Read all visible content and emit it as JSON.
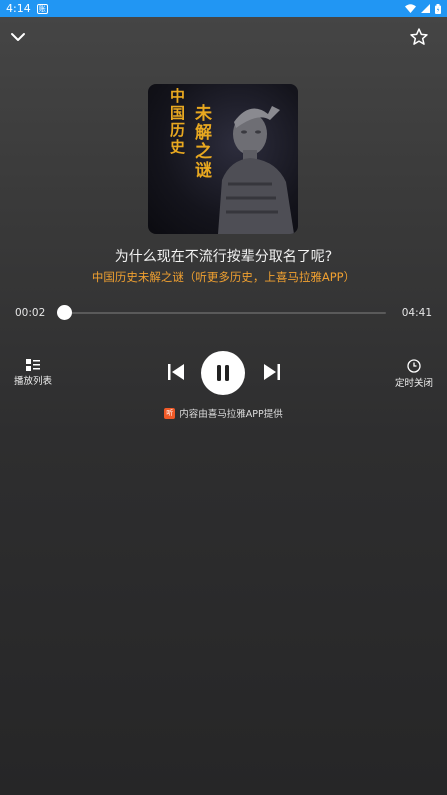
{
  "status_bar": {
    "time": "4:14",
    "notification_glyph": "账",
    "icons": [
      "wifi-icon",
      "signal-icon",
      "battery-icon"
    ],
    "background": "#2196f3"
  },
  "header": {
    "collapse_icon": "chevron-down-icon",
    "favorite_icon": "star-outline-icon"
  },
  "cover": {
    "text_left": "中国历史",
    "text_right": "未解之谜",
    "accent": "#e8a820"
  },
  "track": {
    "title": "为什么现在不流行按辈分取名了呢?",
    "subtitle": "中国历史未解之谜（听更多历史，上喜马拉雅APP）",
    "subtitle_color": "#f0a030"
  },
  "progress": {
    "current": "00:02",
    "total": "04:41",
    "fraction": 0.007
  },
  "controls": {
    "playlist_label": "播放列表",
    "timer_label": "定时关闭",
    "prev_icon": "skip-previous-icon",
    "play_state_icon": "pause-icon",
    "next_icon": "skip-next-icon"
  },
  "credit": {
    "logo_glyph": "听",
    "text": "内容由喜马拉雅APP提供"
  }
}
